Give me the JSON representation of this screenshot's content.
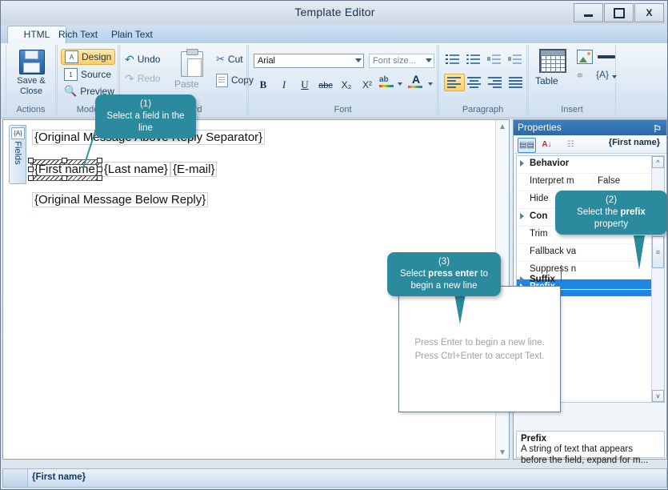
{
  "window": {
    "title": "Template Editor",
    "minimize_label": "minimize",
    "maximize_label": "maximize",
    "close_label": "X"
  },
  "tabs": [
    {
      "label": "HTML",
      "active": true
    },
    {
      "label": "Rich Text",
      "active": false
    },
    {
      "label": "Plain Text",
      "active": false
    }
  ],
  "ribbon": {
    "groups": [
      {
        "label": "Actions"
      },
      {
        "label": "Mode"
      },
      {
        "label": "Clipboard"
      },
      {
        "label": "Font"
      },
      {
        "label": "Paragraph"
      },
      {
        "label": "Insert"
      }
    ],
    "actions": {
      "save_close": "Save &\nClose"
    },
    "mode": {
      "design": "Design",
      "source": "Source",
      "preview": "Preview"
    },
    "clipboard": {
      "undo": "Undo",
      "redo": "Redo",
      "paste": "Paste",
      "cut": "Cut",
      "copy": "Copy"
    },
    "font": {
      "family_value": "Arial",
      "size_placeholder": "Font size...",
      "bold": "B",
      "italic": "I",
      "underline": "U",
      "strike": "abc",
      "subscript": "X₂",
      "superscript": "X²",
      "highlight": "ab",
      "fontcolor": "A"
    },
    "paragraph": {
      "numbered_list": "numbered-list",
      "bulleted_list": "bulleted-list",
      "decrease_indent": "decrease-indent",
      "increase_indent": "increase-indent",
      "align_left": "align-left",
      "align_center": "align-center",
      "align_right": "align-right",
      "align_justify": "align-justify"
    },
    "insert": {
      "table": "Table",
      "image": "image",
      "hr": "horizontal-rule",
      "link": "link",
      "field": "{A}"
    }
  },
  "left_pane": {
    "fields_tab": {
      "label": "Fields",
      "icon": "{A}"
    },
    "lines": [
      {
        "text": "{Original Message Above Reply Separator}"
      },
      {
        "text": "{First name}",
        "selected": true
      },
      {
        "text": "{Last name}"
      },
      {
        "text": "{E-mail}"
      },
      {
        "text": "{Original Message Below Reply}"
      }
    ]
  },
  "properties": {
    "header": "Properties",
    "pin": "⚐",
    "toolbar": {
      "categorized": "categorized-view",
      "alphabetical": "A↓",
      "property_pages": "property-pages",
      "selected_object": "{First name}"
    },
    "rows": [
      {
        "name": "Behavior",
        "value": "",
        "category": true,
        "selected": false
      },
      {
        "name": "Interpret m",
        "value": "False",
        "category": false,
        "selected": false
      },
      {
        "name": "Hide",
        "value": "",
        "category": false,
        "selected": false
      },
      {
        "name": "Con",
        "value": "",
        "category": true,
        "selected": false
      },
      {
        "name": "Trim",
        "value": "",
        "category": false,
        "selected": false
      },
      {
        "name": "Fallback va",
        "value": "",
        "category": false,
        "selected": false
      },
      {
        "name": "Suppress n",
        "value": "",
        "category": false,
        "selected": false
      },
      {
        "name": "Prefix",
        "value": "",
        "category": true,
        "selected": true
      },
      {
        "name": "Suffix",
        "value": "",
        "category": true,
        "selected": false
      }
    ],
    "description": {
      "title": "Prefix",
      "text": "A string of text that appears before the field, expand for m..."
    }
  },
  "drop_editor": {
    "hint_line_1": "Press Enter to begin a new line.",
    "hint_line_2": "Press Ctrl+Enter to accept Text."
  },
  "callouts": [
    {
      "number": "(1)",
      "text_before": "Select a field in the line",
      "bold": "",
      "text_after": ""
    },
    {
      "number": "(2)",
      "text_before": "Select the ",
      "bold": "prefix",
      "text_after": " property"
    },
    {
      "number": "(3)",
      "text_before": "Select ",
      "bold": "press enter",
      "text_after": " to begin a new line"
    }
  ],
  "status_bar": {
    "text": "{First name}"
  },
  "colors": {
    "callout_teal": "#2b8a9e",
    "title_blue": "#2c68a8",
    "selection_blue": "#1d87e8",
    "highlight_orange": "#ffcf66"
  }
}
